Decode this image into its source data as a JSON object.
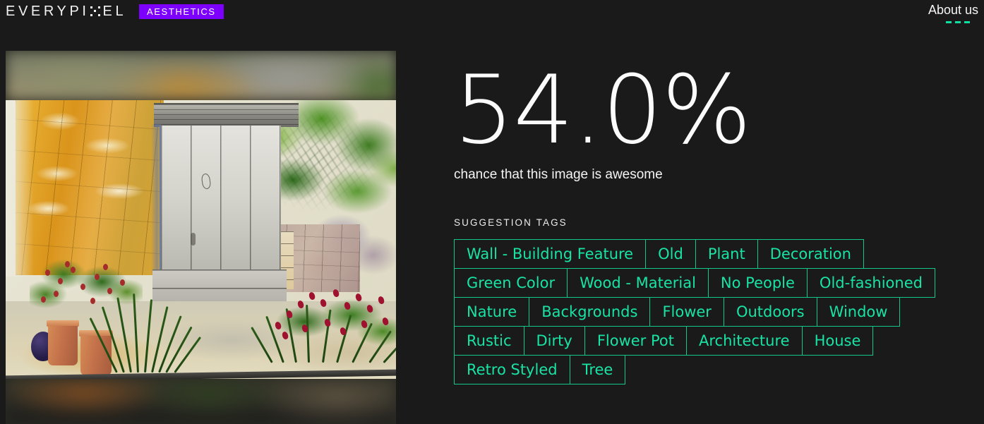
{
  "header": {
    "brand_prefix": "EVERYPI",
    "brand_suffix": "EL",
    "brand_full": "EVERYPIXEL",
    "badge": "AESTHETICS",
    "about_us": "About us"
  },
  "result": {
    "score": "54.0%",
    "caption": "chance that this image is awesome"
  },
  "tags_section": {
    "label": "SUGGESTION TAGS",
    "tags": [
      "Wall - Building Feature",
      "Old",
      "Plant",
      "Decoration",
      "Green Color",
      "Wood - Material",
      "No People",
      "Old-fashioned",
      "Nature",
      "Backgrounds",
      "Flower",
      "Outdoors",
      "Window",
      "Rustic",
      "Dirty",
      "Flower Pot",
      "Architecture",
      "House",
      "Retro Styled",
      "Tree"
    ]
  },
  "preview": {
    "alt": "watercolor painting of rustic wooden door in stone wall with ivy, terracotta flower pots and red flowers"
  },
  "colors": {
    "background": "#1a1a1a",
    "accent_teal": "#19e3a4",
    "badge_purple": "#7d00ff",
    "text": "#ffffff"
  }
}
